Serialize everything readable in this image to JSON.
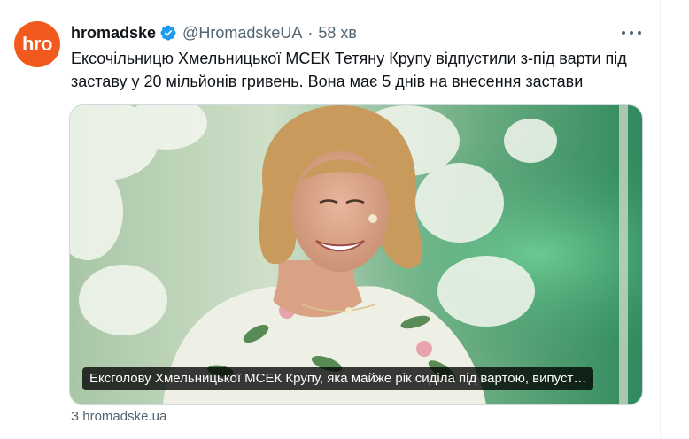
{
  "tweet": {
    "avatar_text": "hro",
    "author_name": "hromadske",
    "handle": "@HromadskeUA",
    "separator": "·",
    "time": "58 хв",
    "text": "Ексочільницю Хмельницької МСЕК Тетяну Крупу відпустили з-під варти під заставу у 20 мільйонів гривень. Вона має 5 днів на внесення застави",
    "media_caption": "Ексголову Хмельницької МСЕК Крупу, яка майже рік сиділа під вартою, випуст…",
    "link_source": "З hromadske.ua"
  },
  "colors": {
    "brand": "#f25a1d",
    "verified": "#1d9bf0",
    "secondary_text": "#536471"
  },
  "icons": {
    "verified": "verified-badge-icon",
    "more": "more-dots-icon"
  }
}
